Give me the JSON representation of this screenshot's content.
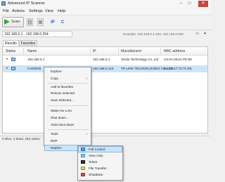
{
  "window": {
    "title": "Advanced IP Scanner",
    "minimize": "–",
    "maximize": "□",
    "close": "✕"
  },
  "menu": [
    "File",
    "Actions",
    "Settings",
    "View",
    "Help"
  ],
  "toolbar": {
    "scan_label": "Scan",
    "tool_ip": "IP",
    "tool_c": "C"
  },
  "range": {
    "value": "192.168.0.1 - 192.168.0.254",
    "example": "Example: 192.168.0.1-100, 192.168.0.200"
  },
  "tabs": [
    "Results",
    "Favorites"
  ],
  "table": {
    "columns": [
      "Status",
      "Name",
      "IP",
      "Manufacturer",
      "MAC address"
    ],
    "rows": [
      {
        "name": "192.168.0.1",
        "ip": "192.168.0.1",
        "manufacturer": "Tenda Technology Co.,Ltd.",
        "mac": "C8:3A:35:6A:FD:90",
        "selected": false
      },
      {
        "name": "CARDO5",
        "ip": "192.168.0.123",
        "manufacturer": "TP-LINK TECHNOLOGIES CO.,LTD.",
        "mac": "6C:E3:17:73:7C:E8",
        "selected": true
      }
    ]
  },
  "context_menu": {
    "items": [
      "Explore",
      "Copy",
      "Add to favorites",
      "Rescan selected",
      "Save selected...",
      "Wake-On-LAN",
      "Shut down...",
      "Abort shut down",
      "Tools",
      "RDP",
      "Radmin"
    ]
  },
  "radmin_submenu": {
    "items": [
      "Full Control",
      "View Only",
      "Telnet",
      "File Transfer",
      "Shutdown"
    ],
    "icons": [
      "monitor-icon",
      "eye-icon",
      "terminal-icon",
      "folder-icon",
      "power-icon"
    ]
  },
  "status": {
    "text": "0 alive, 2 dead, 252 unkno"
  },
  "colors": {
    "selection": "#cde4f7",
    "scan_play": "#3aa43a",
    "close_button": "#c9453a"
  }
}
